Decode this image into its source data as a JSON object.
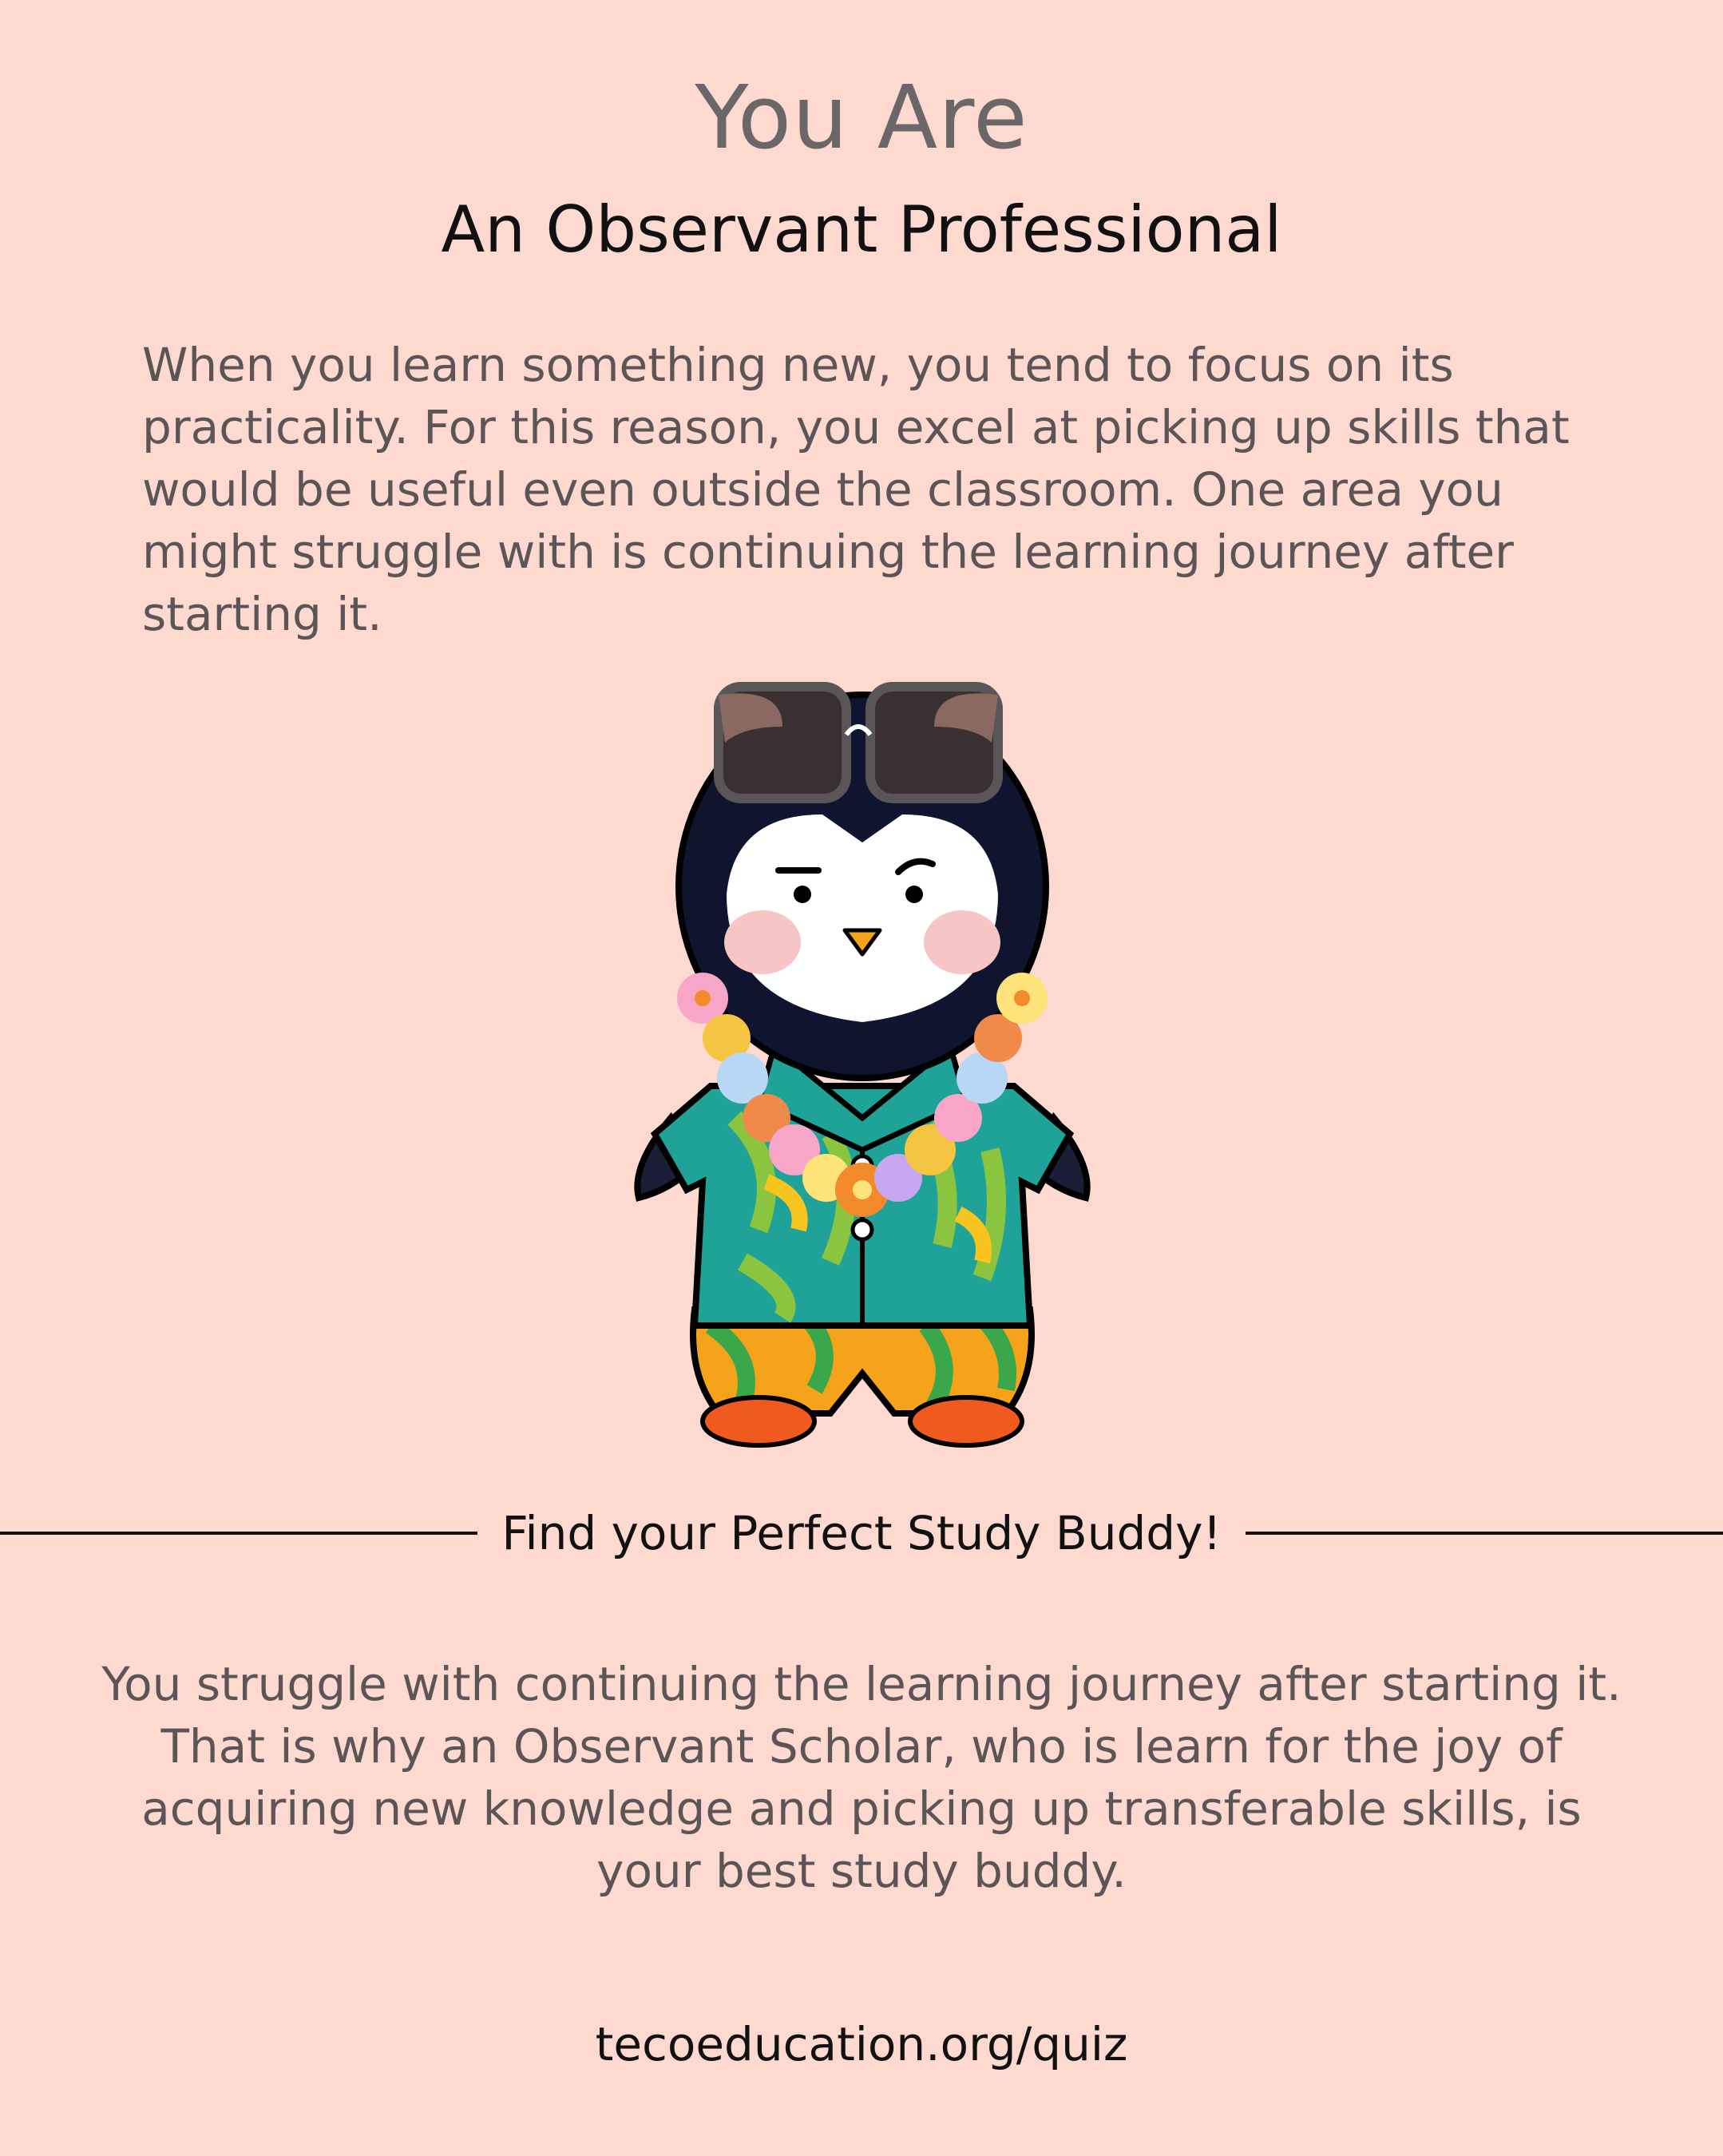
{
  "header": {
    "kicker": "You Are",
    "title": "An Observant Professional"
  },
  "description": "When you learn something new, you tend to focus on its practicality. For this reason, you excel at picking up skills that would be useful even outside the classroom. One area you might struggle with is continuing the learning journey after starting it.",
  "illustration": {
    "icon": "penguin-mascot-icon",
    "accessories": [
      "sunglasses-icon",
      "flower-lei-icon",
      "hawaiian-shirt-icon"
    ]
  },
  "divider": {
    "label": "Find your Perfect Study Buddy!"
  },
  "buddy_text": "You struggle with continuing the learning journey after starting it. That is why an Observant Scholar, who is learn for the joy of acquiring new knowledge and picking up transferable skills, is your best study buddy.",
  "footer": {
    "url": "tecoeducation.org/quiz"
  },
  "colors": {
    "background": "#fdd9d0",
    "heading": "#6b6668",
    "title": "#111111",
    "body": "#5c5557"
  }
}
